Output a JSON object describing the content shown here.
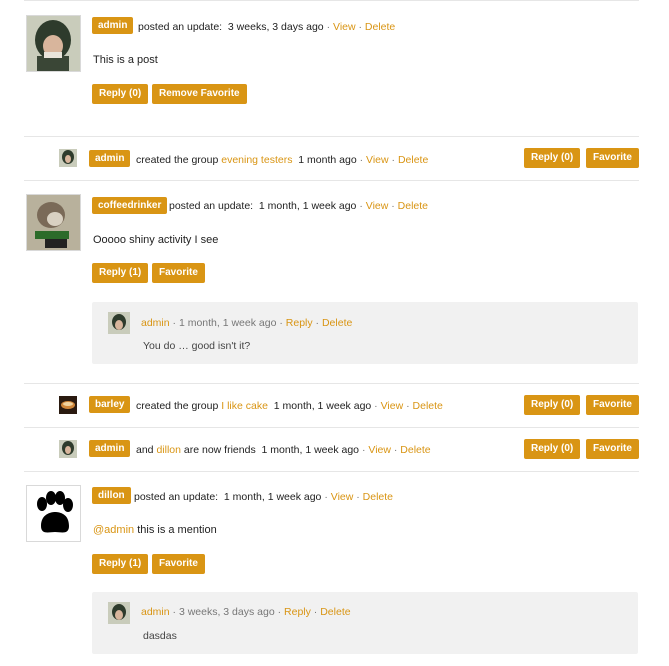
{
  "a1": {
    "user": "admin",
    "action": "posted an update:",
    "time": "3 weeks, 3 days ago",
    "view": "View",
    "sep": " · ",
    "delete": "Delete",
    "content": "This is a post",
    "reply": "Reply (0)",
    "favorite": "Remove Favorite"
  },
  "a2": {
    "user": "admin",
    "action": "created the group",
    "group": "evening testers",
    "time": "1 month ago",
    "view": "View",
    "delete": "Delete",
    "reply": "Reply (0)",
    "favorite": "Favorite"
  },
  "a3": {
    "user": "coffeedrinker",
    "action": "posted an update:",
    "time": "1 month, 1 week ago",
    "view": "View",
    "delete": "Delete",
    "content": "Ooooo shiny activity I see",
    "reply": "Reply (1)",
    "favorite": "Favorite",
    "comment": {
      "user": "admin",
      "time": "· 1 month, 1 week ago ·",
      "reply": "Reply",
      "delete": "Delete",
      "text": "You do … good isn't it?"
    }
  },
  "a4": {
    "user": "barley",
    "action": "created the group",
    "group": "I like cake",
    "time": "1 month, 1 week ago",
    "view": "View",
    "delete": "Delete",
    "reply": "Reply (0)",
    "favorite": "Favorite"
  },
  "a5": {
    "user": "admin",
    "and": "and",
    "friend": "dillon",
    "action": "are now friends",
    "time": "1 month, 1 week ago",
    "view": "View",
    "delete": "Delete",
    "reply": "Reply (0)",
    "favorite": "Favorite"
  },
  "a6": {
    "user": "dillon",
    "action": "posted an update:",
    "time": "1 month, 1 week ago",
    "view": "View",
    "delete": "Delete",
    "mention": "@admin",
    "content": "this is a mention",
    "reply": "Reply (1)",
    "favorite": "Favorite",
    "comment": {
      "user": "admin",
      "time": "· 3 weeks, 3 days ago ·",
      "reply": "Reply",
      "delete": "Delete",
      "text": "dasdas"
    }
  },
  "colors": {
    "accent": "#d99514",
    "comment_bg": "#f1f1f1"
  }
}
